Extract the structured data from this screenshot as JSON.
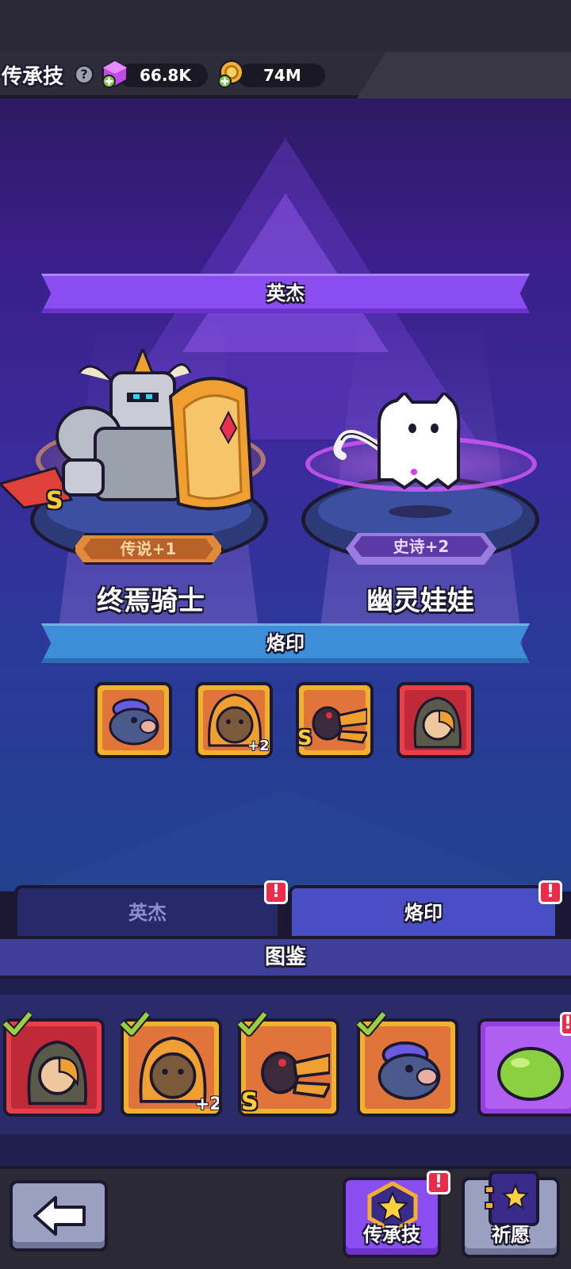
{
  "header": {
    "title": "传承技",
    "help_icon": "help-icon",
    "gems": "66.8K",
    "coins": "74M"
  },
  "stage": {
    "heroes_banner": "英杰",
    "imprint_banner": "烙印",
    "hero_left": {
      "name": "终焉骑士",
      "rank": "传说+1",
      "grade": "S"
    },
    "hero_right": {
      "name": "幽灵娃娃",
      "rank": "史诗+2"
    },
    "imprint_slots": [
      {
        "icon": "fish-warrior-icon",
        "frame": "gold"
      },
      {
        "icon": "hooded-bear-icon",
        "frame": "gold",
        "plus": "+2"
      },
      {
        "icon": "crow-icon",
        "frame": "gold",
        "grade": "S"
      },
      {
        "icon": "hooded-rogue-icon",
        "frame": "red"
      }
    ]
  },
  "tabs": [
    {
      "label": "英杰",
      "alert": "!"
    },
    {
      "label": "烙印",
      "alert": "!"
    }
  ],
  "codex": {
    "title": "图鉴",
    "cards": [
      {
        "icon": "hooded-rogue-icon",
        "frame": "red",
        "checked": true
      },
      {
        "icon": "hooded-bear-icon",
        "frame": "gold",
        "checked": true,
        "plus": "+2"
      },
      {
        "icon": "crow-icon",
        "frame": "gold",
        "checked": true,
        "grade": "S"
      },
      {
        "icon": "fish-warrior-icon",
        "frame": "gold",
        "checked": true
      },
      {
        "icon": "slime-icon",
        "frame": "purple",
        "alert": "!"
      }
    ]
  },
  "bottom_nav": {
    "back": "arrow-left-icon",
    "legacy_label": "传承技",
    "legacy_alert": "!",
    "wish_label": "祈愿"
  },
  "colors": {
    "heroes_banner": "#8a4df0",
    "imprint_banner": "#3c8ed8",
    "alert": "#ee2a4a",
    "gold_frame": "#f0b22e",
    "red_frame": "#e8404a"
  }
}
